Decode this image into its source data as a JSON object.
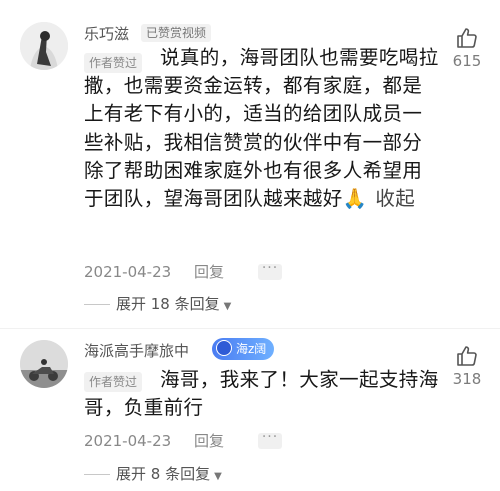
{
  "comments": [
    {
      "username": "乐巧滋",
      "tag": "已赞赏视频",
      "author_liked": "作者赞过",
      "text": "说真的，海哥团队也需要吃喝拉撒，也需要资金运转，都有家庭，都是上有老下有小的，适当的给团队成员一些补贴，我相信赞赏的伙伴中有一部分除了帮助困难家庭外也有很多人希望用于团队，望海哥团队越来越好",
      "emoji": "🙏",
      "collapse_label": "收起",
      "date": "2021-04-23",
      "reply_label": "回复",
      "like_count": "615",
      "expand_label": "展开 18 条回复"
    },
    {
      "username": "海派高手摩旅中",
      "badge": "海z阔",
      "author_liked": "作者赞过",
      "text": "海哥，我来了！大家一起支持海哥，负重前行",
      "date": "2021-04-23",
      "reply_label": "回复",
      "like_count": "318",
      "expand_label": "展开 8 条回复"
    }
  ],
  "icons": {
    "like": "thumbs-up-icon",
    "more": "more-dots-icon",
    "caret": "chevron-down-icon"
  }
}
